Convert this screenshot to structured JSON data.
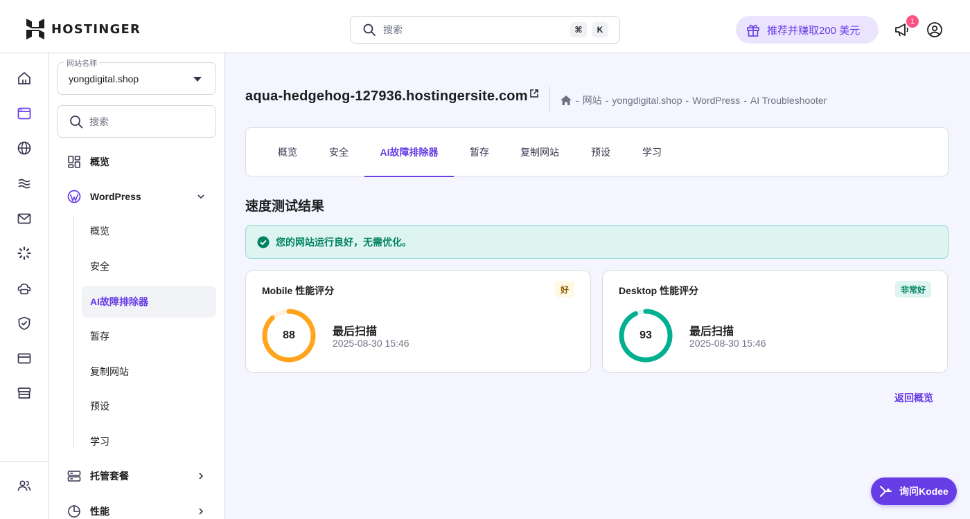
{
  "header": {
    "brand": "HOSTINGER",
    "search_placeholder": "搜索",
    "shortcut_keys": [
      "⌘",
      "K"
    ],
    "referral_label": "推荐并赚取200 美元",
    "notification_count": "1"
  },
  "rail": {
    "icons": [
      "home-icon",
      "website-icon",
      "globe-icon",
      "layers-icon",
      "mail-icon",
      "loader-icon",
      "cloud-icon",
      "shield-icon",
      "card-icon",
      "store-icon",
      "users-icon"
    ]
  },
  "sidebar": {
    "site_label": "网站名称",
    "site_value": "yongdigital.shop",
    "search_placeholder": "搜索",
    "items": [
      {
        "label": "概览"
      },
      {
        "label": "WordPress"
      },
      {
        "label": "托管套餐"
      },
      {
        "label": "性能"
      }
    ],
    "wp_sub_items": [
      {
        "label": "概览"
      },
      {
        "label": "安全"
      },
      {
        "label": "AI故障排除器"
      },
      {
        "label": "暂存"
      },
      {
        "label": "复制网站"
      },
      {
        "label": "预设"
      },
      {
        "label": "学习"
      }
    ]
  },
  "main": {
    "title": "aqua-hedgehog-127936.hostingersite.com",
    "breadcrumb": [
      "网站",
      "yongdigital.shop",
      "WordPress",
      "AI Troubleshooter"
    ],
    "breadcrumb_sep": "-",
    "tabs": [
      {
        "label": "概览"
      },
      {
        "label": "安全"
      },
      {
        "label": "AI故障排除器"
      },
      {
        "label": "暂存"
      },
      {
        "label": "复制网站"
      },
      {
        "label": "预设"
      },
      {
        "label": "学习"
      }
    ],
    "section_title": "速度测试结果",
    "alert_text": "您的网站运行良好，无需优化。",
    "cards": [
      {
        "title": "Mobile 性能评分",
        "badge": "好",
        "score": "88",
        "score_value": 88,
        "scan_title": "最后扫描",
        "scan_date": "2025-08-30 15:46",
        "color": "#ffa41c",
        "badge_bg": "#fff8e2",
        "badge_fg": "#8a5b00"
      },
      {
        "title": "Desktop 性能评分",
        "badge": "非常好",
        "score": "93",
        "score_value": 93,
        "scan_title": "最后扫描",
        "scan_date": "2025-08-30 15:46",
        "color": "#00b090",
        "badge_bg": "#def4f0",
        "badge_fg": "#008361"
      }
    ],
    "back_link": "返回概览"
  },
  "kodee": {
    "label": "询问Kodee"
  },
  "colors": {
    "accent": "#673de6",
    "success": "#00b090",
    "warning": "#ffa41c"
  }
}
